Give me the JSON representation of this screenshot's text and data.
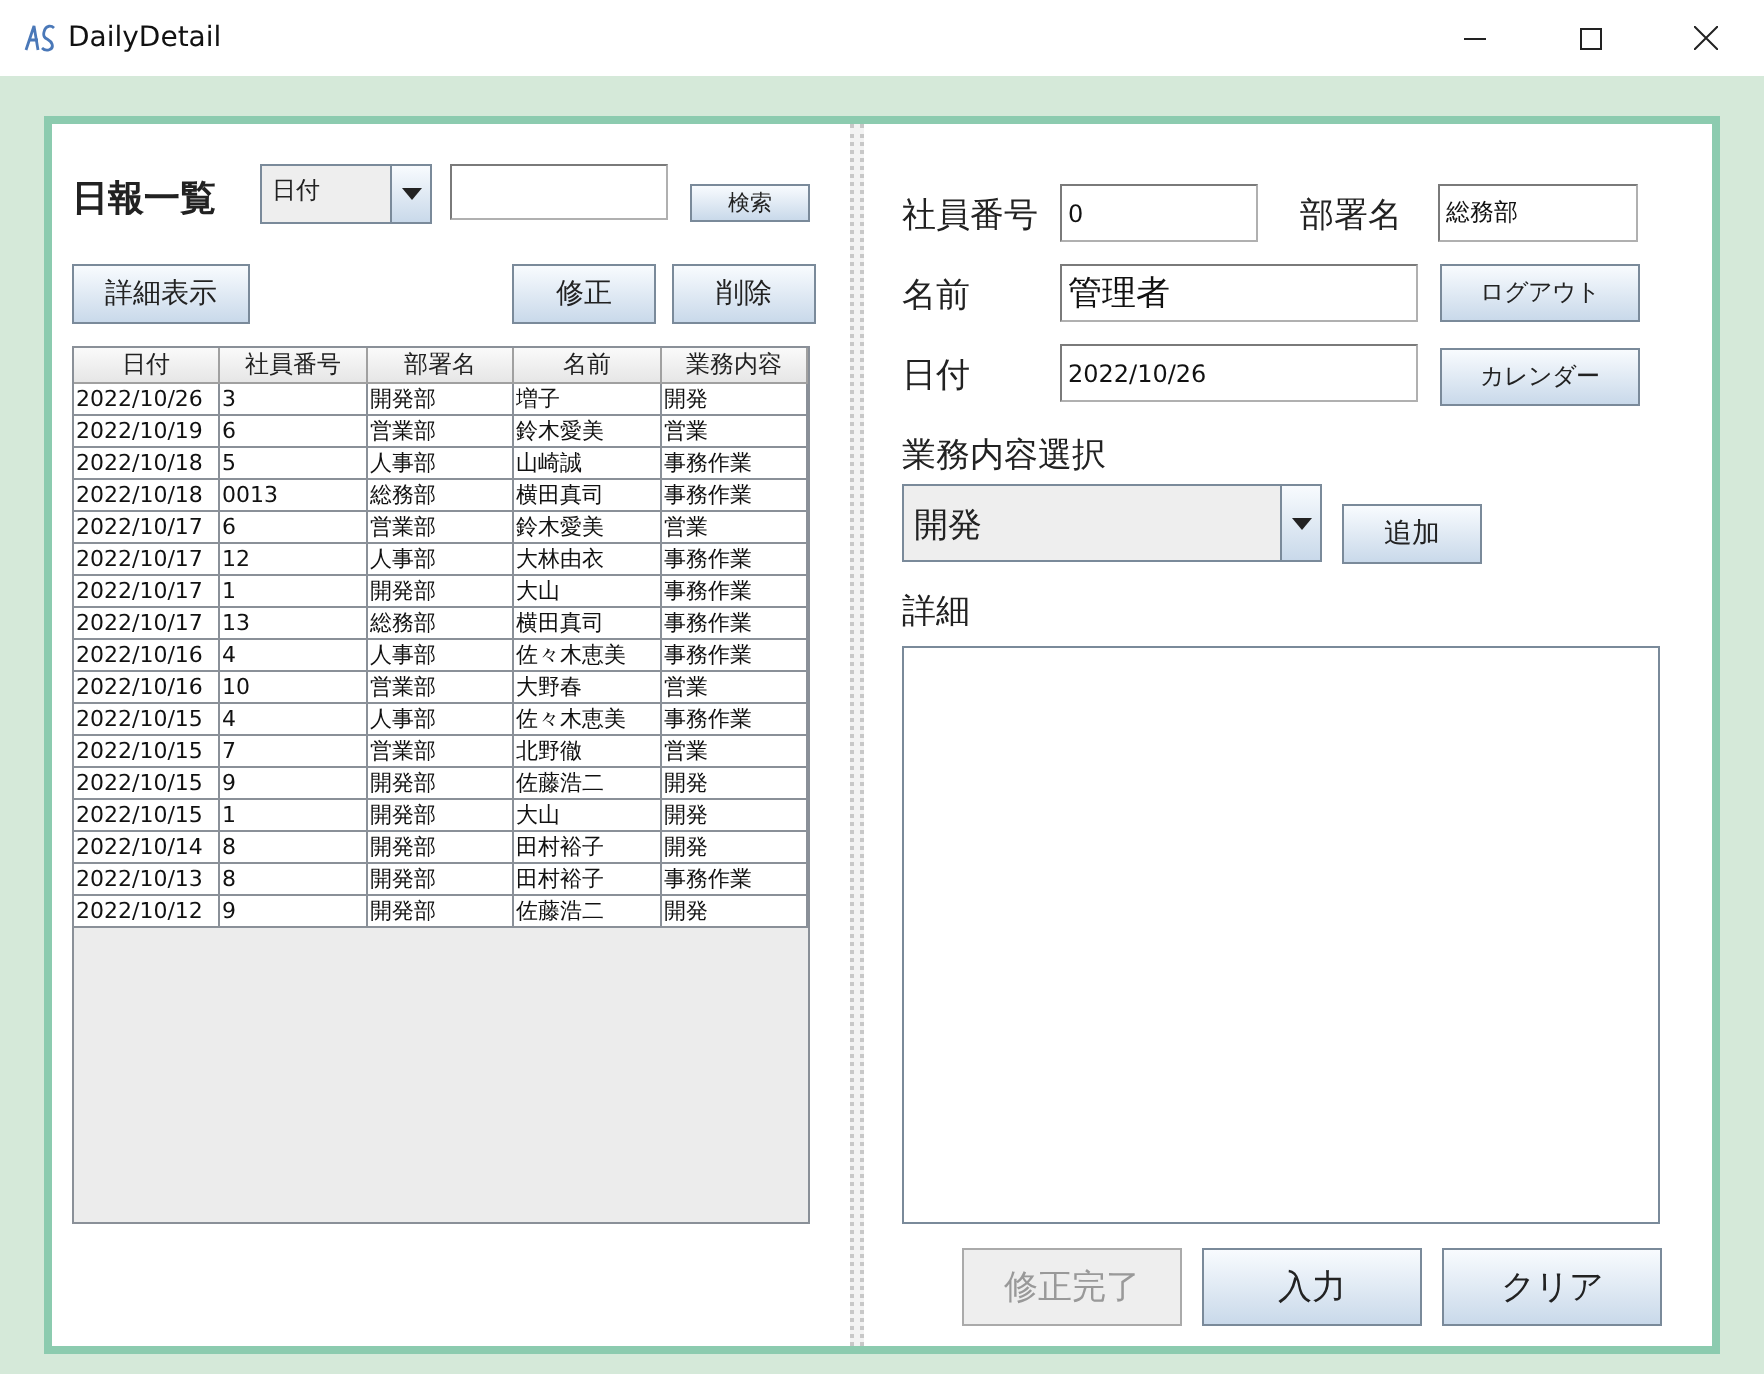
{
  "window": {
    "title": "DailyDetail"
  },
  "list_panel": {
    "heading": "日報一覧",
    "search_combo": {
      "value": "日付"
    },
    "search_button": "検索",
    "buttons": [
      {
        "label": "詳細表示",
        "kind": "left"
      },
      {
        "label": "修正",
        "kind": "right"
      },
      {
        "label": "削除",
        "kind": "right"
      }
    ]
  },
  "table": {
    "columns": [
      "日付",
      "社員番号",
      "部署名",
      "名前",
      "業務内容"
    ],
    "rows": [
      [
        "2022/10/26",
        "3",
        "開発部",
        "増子",
        "開発"
      ],
      [
        "2022/10/19",
        "6",
        "営業部",
        "鈴木愛美",
        "営業"
      ],
      [
        "2022/10/18",
        "5",
        "人事部",
        "山崎誠",
        "事務作業"
      ],
      [
        "2022/10/18",
        "0013",
        "総務部",
        "横田真司",
        "事務作業"
      ],
      [
        "2022/10/17",
        "6",
        "営業部",
        "鈴木愛美",
        "営業"
      ],
      [
        "2022/10/17",
        "12",
        "人事部",
        "大林由衣",
        "事務作業"
      ],
      [
        "2022/10/17",
        "1",
        "開発部",
        "大山",
        "事務作業"
      ],
      [
        "2022/10/17",
        "13",
        "総務部",
        "横田真司",
        "事務作業"
      ],
      [
        "2022/10/16",
        "4",
        "人事部",
        "佐々木恵美",
        "事務作業"
      ],
      [
        "2022/10/16",
        "10",
        "営業部",
        "大野春",
        "営業"
      ],
      [
        "2022/10/15",
        "4",
        "人事部",
        "佐々木恵美",
        "事務作業"
      ],
      [
        "2022/10/15",
        "7",
        "営業部",
        "北野徹",
        "営業"
      ],
      [
        "2022/10/15",
        "9",
        "開発部",
        "佐藤浩二",
        "開発"
      ],
      [
        "2022/10/15",
        "1",
        "開発部",
        "大山",
        "開発"
      ],
      [
        "2022/10/14",
        "8",
        "開発部",
        "田村裕子",
        "開発"
      ],
      [
        "2022/10/13",
        "8",
        "開発部",
        "田村裕子",
        "事務作業"
      ],
      [
        "2022/10/12",
        "9",
        "開発部",
        "佐藤浩二",
        "開発"
      ]
    ]
  },
  "form": {
    "employee_no": {
      "label": "社員番号",
      "value": "0"
    },
    "department": {
      "label": "部署名",
      "value": "総務部"
    },
    "name": {
      "label": "名前",
      "value": "管理者"
    },
    "logout_button": "ログアウト",
    "date": {
      "label": "日付",
      "value": "2022/10/26"
    },
    "calendar_button": "カレンダー",
    "task_label": "業務内容選択",
    "task_combo": {
      "value": "開発"
    },
    "add_button": "追加",
    "detail_label": "詳細",
    "actions": [
      {
        "label": "修正完了",
        "disabled": true
      },
      {
        "label": "入力",
        "disabled": false
      },
      {
        "label": "クリア",
        "disabled": false
      }
    ]
  }
}
